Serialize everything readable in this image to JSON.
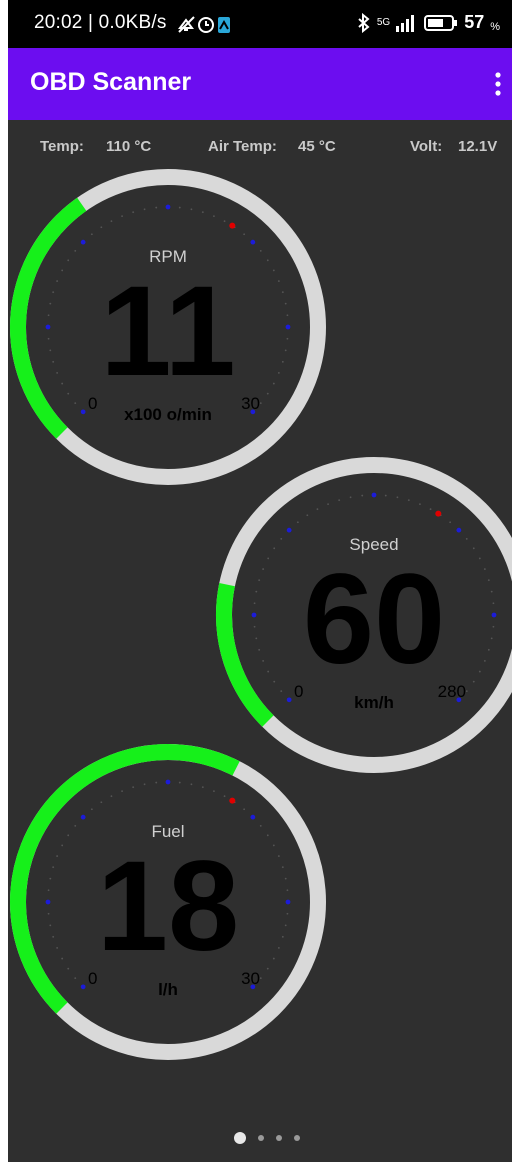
{
  "status_bar": {
    "time": "20:02 | 0.0KB/s",
    "network": "5G",
    "battery": "57"
  },
  "app_bar": {
    "title": "OBD Scanner"
  },
  "info": {
    "temp_label": "Temp:",
    "temp_value": "110 °C",
    "air_label": "Air Temp:",
    "air_value": "45 °C",
    "volt_label": "Volt:",
    "volt_value": "12.1V"
  },
  "gauges": [
    {
      "name": "rpm",
      "title": "RPM",
      "value": "11",
      "unit": "x100 o/min",
      "min": "0",
      "max": "30",
      "fill_fraction": 0.37
    },
    {
      "name": "speed",
      "title": "Speed",
      "value": "60",
      "unit": "km/h",
      "min": "0",
      "max": "280",
      "fill_fraction": 0.21
    },
    {
      "name": "fuel",
      "title": "Fuel",
      "value": "18",
      "unit": "l/h",
      "min": "0",
      "max": "30",
      "fill_fraction": 0.6
    }
  ],
  "colors": {
    "primary": "#6c0df0",
    "gauge_fill": "#16f01a",
    "gauge_track": "#d9d9d9",
    "needle_red": "#e00000",
    "tick_blue": "#1c1cd8"
  },
  "pager": {
    "pages": 4,
    "active": 0
  }
}
